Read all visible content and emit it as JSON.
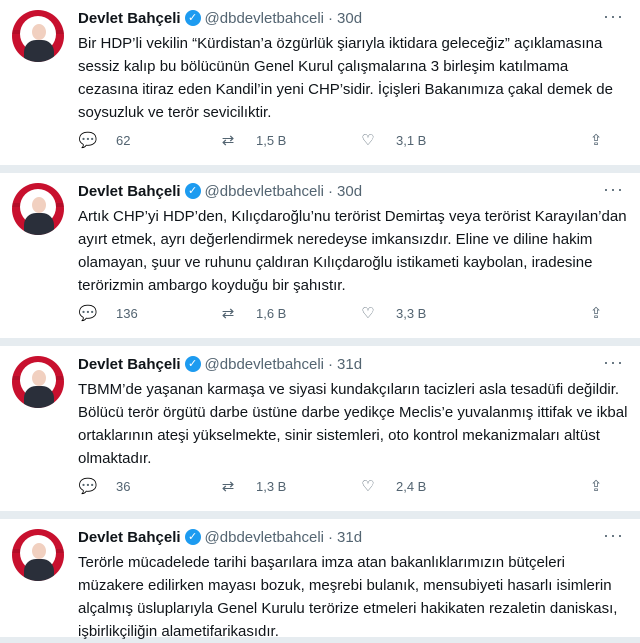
{
  "tweets": [
    {
      "name": "Devlet Bahçeli",
      "handle": "@dbdevletbahceli",
      "time": "30d",
      "text": "Bir HDP’li vekilin “Kürdistan’a özgürlük şiarıyla iktidara geleceğiz” açıklamasına sessiz kalıp bu bölücünün Genel Kurul çalışmalarına 3 birleşim katılmama cezasına itiraz eden Kandil’in yeni CHP’sidir. İçişleri Bakanımıza çakal demek de soysuzluk ve terör sevicilıktir.",
      "replies": "62",
      "retweets": "1,5 B",
      "likes": "3,1 B"
    },
    {
      "name": "Devlet Bahçeli",
      "handle": "@dbdevletbahceli",
      "time": "30d",
      "text": "Artık CHP’yi HDP’den, Kılıçdaroğlu’nu terörist Demirtaş veya terörist Karayılan’dan ayırt etmek, ayrı değerlendirmek neredeyse imkansızdır.  Eline ve diline hakim olamayan, şuur ve ruhunu çaldıran Kılıçdaroğlu istikameti kaybolan, iradesine terörizmin ambargo koyduğu bir şahıstır.",
      "replies": "136",
      "retweets": "1,6 B",
      "likes": "3,3 B"
    },
    {
      "name": "Devlet Bahçeli",
      "handle": "@dbdevletbahceli",
      "time": "31d",
      "text": "TBMM’de yaşanan karmaşa ve siyasi kundakçıların tacizleri asla tesadüfi değildir. Bölücü terör örgütü darbe üstüne darbe yedikçe Meclis’e yuvalanmış ittifak ve ikbal ortaklarının ateşi yükselmekte, sinir sistemleri, oto kontrol mekanizmaları altüst olmaktadır.",
      "replies": "36",
      "retweets": "1,3 B",
      "likes": "2,4 B"
    },
    {
      "name": "Devlet Bahçeli",
      "handle": "@dbdevletbahceli",
      "time": "31d",
      "text": "Terörle mücadelede tarihi başarılara imza atan bakanlıklarımızın bütçeleri müzakere edilirken mayası bozuk, meşrebi bulanık, mensubiyeti hasarlı isimlerin alçalmış üsluplarıyla Genel Kurulu terörize etmeleri hakikaten rezaletin daniskası, işbirlikçiliğin alametifarikasıdır."
    }
  ],
  "icons": {
    "verified": "verified-badge-icon",
    "more": "more-icon",
    "reply": "reply-icon",
    "retweet": "retweet-icon",
    "like": "like-icon",
    "share": "share-icon"
  },
  "colors": {
    "verified": "#1d9bf0",
    "secondary_text": "#536471",
    "divider": "#e6ecf0"
  }
}
